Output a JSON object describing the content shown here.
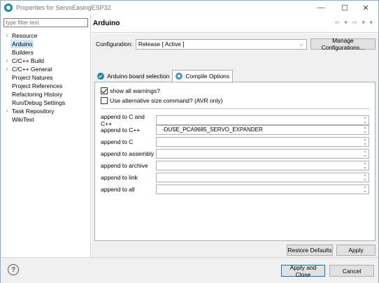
{
  "window": {
    "title": "Properties for ServoEasingESP32",
    "minimize_glyph": "—",
    "maximize_glyph": "☐",
    "close_glyph": "✕"
  },
  "sidebar": {
    "filter_placeholder": "type filter text",
    "items": [
      {
        "label": "Resource",
        "expandable": true
      },
      {
        "label": "Arduino",
        "expandable": false,
        "selected": true
      },
      {
        "label": "Builders",
        "expandable": false
      },
      {
        "label": "C/C++ Build",
        "expandable": true
      },
      {
        "label": "C/C++ General",
        "expandable": true
      },
      {
        "label": "Project Natures",
        "expandable": false
      },
      {
        "label": "Project References",
        "expandable": false
      },
      {
        "label": "Refactoring History",
        "expandable": false
      },
      {
        "label": "Run/Debug Settings",
        "expandable": false
      },
      {
        "label": "Task Repository",
        "expandable": true
      },
      {
        "label": "WikiText",
        "expandable": false
      }
    ]
  },
  "main": {
    "page_title": "Arduino",
    "nav_arrows": "⇦ ▾ ⇨ ▾ ▾",
    "configuration_label": "Configuration:",
    "configuration_value": "Release  [ Active ]",
    "manage_configurations_label": "Manage Configurations...",
    "tabs": [
      {
        "label": "Arduino board selection",
        "icon": "check-circle-icon",
        "active": false
      },
      {
        "label": "Compile Options",
        "icon": "gear-icon",
        "active": true
      }
    ],
    "options": {
      "show_all_warnings": {
        "label": "show all warnings?",
        "checked": true
      },
      "alt_size_command": {
        "label": "Use alternative size command? (AVR only)",
        "checked": false
      }
    },
    "fields": [
      {
        "label": "append to C and C++",
        "value": ""
      },
      {
        "label": "append to C++",
        "value": "-DUSE_PCA9685_SERVO_EXPANDER"
      },
      {
        "label": "append to C",
        "value": ""
      },
      {
        "label": "append to assembly",
        "value": ""
      },
      {
        "label": "append to archive",
        "value": ""
      },
      {
        "label": "append to link",
        "value": ""
      },
      {
        "label": "append to all",
        "value": ""
      }
    ],
    "restore_defaults_label": "Restore Defaults",
    "apply_label": "Apply"
  },
  "footer": {
    "help_glyph": "?",
    "apply_and_close_label": "Apply and Close",
    "cancel_label": "Cancel"
  },
  "colors": {
    "selection": "#cce8ff",
    "accent": "#0078d7",
    "app_icon": "#1c87a5"
  }
}
